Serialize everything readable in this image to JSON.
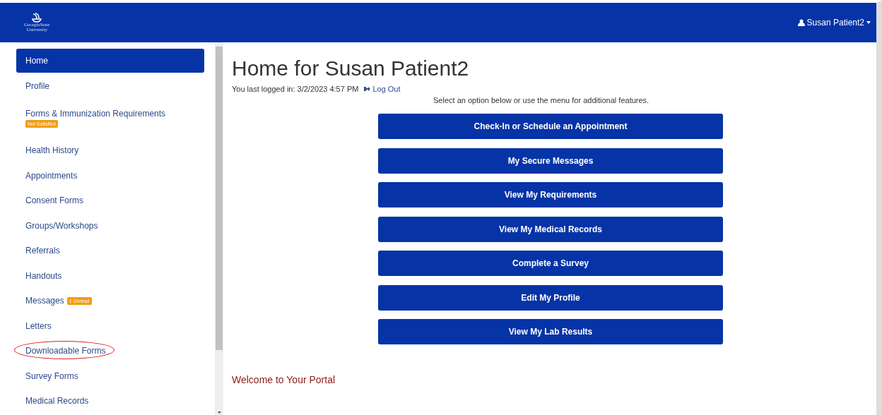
{
  "header": {
    "logo_lines": [
      "GeorgiaState",
      "University"
    ],
    "user": "Susan Patient2"
  },
  "sidebar": {
    "items": [
      {
        "label": "Home",
        "selected": true
      },
      {
        "label": "Profile",
        "selected": false
      },
      {
        "label": "Forms & Immunization Requirements",
        "selected": false,
        "badge": "Not Satisfied",
        "badge_below": true
      },
      {
        "label": "Health History",
        "selected": false
      },
      {
        "label": "Appointments",
        "selected": false
      },
      {
        "label": "Consent Forms",
        "selected": false
      },
      {
        "label": "Groups/Workshops",
        "selected": false
      },
      {
        "label": "Referrals",
        "selected": false
      },
      {
        "label": "Handouts",
        "selected": false
      },
      {
        "label": "Messages",
        "selected": false,
        "badge": "1 Unread",
        "badge_below": false
      },
      {
        "label": "Letters",
        "selected": false
      },
      {
        "label": "Downloadable Forms",
        "selected": false,
        "circled": true
      },
      {
        "label": "Survey Forms",
        "selected": false
      },
      {
        "label": "Medical Records",
        "selected": false
      }
    ]
  },
  "main": {
    "title": "Home for Susan Patient2",
    "last_login": "You last logged in: 3/2/2023 4:57 PM",
    "logout": "Log Out",
    "instructions": "Select an option below or use the menu for additional features.",
    "buttons": [
      "Check-In or Schedule an Appointment",
      "My Secure Messages",
      "View My Requirements",
      "View My Medical Records",
      "Complete a Survey",
      "Edit My Profile",
      "View My Lab Results"
    ],
    "welcome_heading": "Welcome to Your Portal"
  }
}
